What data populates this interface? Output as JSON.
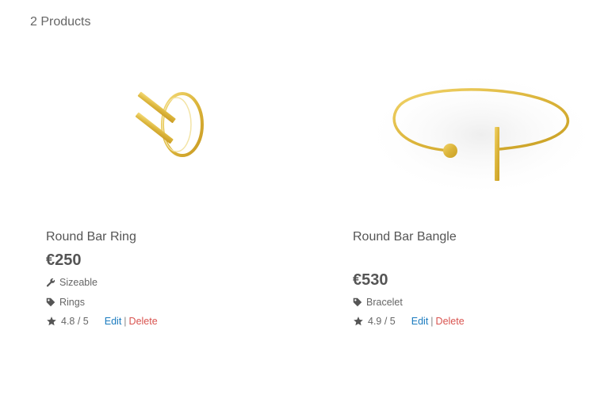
{
  "results": {
    "count_label": "2 Products"
  },
  "products": [
    {
      "name": "Round Bar Ring",
      "price": "€250",
      "attribute": {
        "icon": "wrench-icon",
        "label": "Sizeable"
      },
      "category": {
        "icon": "tag-icon",
        "label": "Rings"
      },
      "rating": "4.8 / 5",
      "edit_label": "Edit",
      "separator": "|",
      "delete_label": "Delete",
      "image": "gold-ring"
    },
    {
      "name": "Round Bar Bangle",
      "price": "€530",
      "category": {
        "icon": "tag-icon",
        "label": "Bracelet"
      },
      "rating": "4.9 / 5",
      "edit_label": "Edit",
      "separator": "|",
      "delete_label": "Delete",
      "image": "gold-bangle"
    }
  ],
  "colors": {
    "gold": "#e2c04a",
    "link": "#1a7bbf",
    "danger": "#d9534f",
    "text": "#555555"
  }
}
